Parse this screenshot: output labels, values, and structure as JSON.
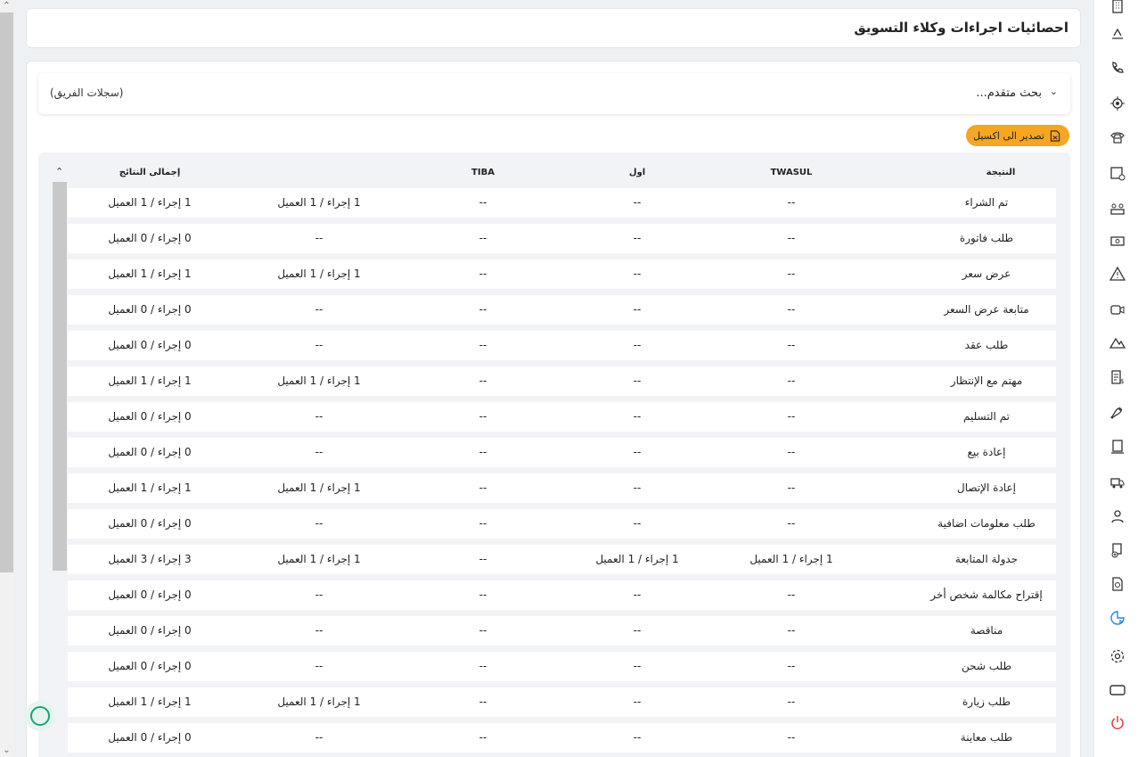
{
  "page_title": "احصائيات اجراءات وكلاء التسويق",
  "advanced_search": {
    "label": "بحث متقدم...",
    "team_records": "(سجلات الفريق)"
  },
  "export_button": "تصدير الى اكسيل",
  "table": {
    "headers": {
      "result": "النتيجة",
      "twasul": "TWASUL",
      "awal": "اول",
      "tiba": "TIBA",
      "other": "",
      "total": "إجمالى النتائج"
    },
    "rows": [
      {
        "result": "تم الشراء",
        "twasul": "--",
        "awal": "--",
        "tiba": "--",
        "other": "1 إجراء / 1 العميل",
        "total": "1 إجراء / 1 العميل"
      },
      {
        "result": "طلب فاتورة",
        "twasul": "--",
        "awal": "--",
        "tiba": "--",
        "other": "--",
        "total": "0 إجراء / 0 العميل"
      },
      {
        "result": "عرض سعر",
        "twasul": "--",
        "awal": "--",
        "tiba": "--",
        "other": "1 إجراء / 1 العميل",
        "total": "1 إجراء / 1 العميل"
      },
      {
        "result": "متابعة عرض السعر",
        "twasul": "--",
        "awal": "--",
        "tiba": "--",
        "other": "--",
        "total": "0 إجراء / 0 العميل"
      },
      {
        "result": "طلب عقد",
        "twasul": "--",
        "awal": "--",
        "tiba": "--",
        "other": "--",
        "total": "0 إجراء / 0 العميل"
      },
      {
        "result": "مهتم مع الإنتظار",
        "twasul": "--",
        "awal": "--",
        "tiba": "--",
        "other": "1 إجراء / 1 العميل",
        "total": "1 إجراء / 1 العميل"
      },
      {
        "result": "تم التسليم",
        "twasul": "--",
        "awal": "--",
        "tiba": "--",
        "other": "--",
        "total": "0 إجراء / 0 العميل"
      },
      {
        "result": "إعادة بيع",
        "twasul": "--",
        "awal": "--",
        "tiba": "--",
        "other": "--",
        "total": "0 إجراء / 0 العميل"
      },
      {
        "result": "إعادة الإتصال",
        "twasul": "--",
        "awal": "--",
        "tiba": "--",
        "other": "1 إجراء / 1 العميل",
        "total": "1 إجراء / 1 العميل"
      },
      {
        "result": "طلب معلومات اضافية",
        "twasul": "--",
        "awal": "--",
        "tiba": "--",
        "other": "--",
        "total": "0 إجراء / 0 العميل"
      },
      {
        "result": "جدولة المتابعة",
        "twasul": "1 إجراء / 1 العميل",
        "awal": "1 إجراء / 1 العميل",
        "tiba": "--",
        "other": "1 إجراء / 1 العميل",
        "total": "3 إجراء / 3 العميل"
      },
      {
        "result": "إقتراح مكالمة شخص أخر",
        "twasul": "--",
        "awal": "--",
        "tiba": "--",
        "other": "--",
        "total": "0 إجراء / 0 العميل"
      },
      {
        "result": "مناقصة",
        "twasul": "--",
        "awal": "--",
        "tiba": "--",
        "other": "--",
        "total": "0 إجراء / 0 العميل"
      },
      {
        "result": "طلب شحن",
        "twasul": "--",
        "awal": "--",
        "tiba": "--",
        "other": "--",
        "total": "0 إجراء / 0 العميل"
      },
      {
        "result": "طلب زيارة",
        "twasul": "--",
        "awal": "--",
        "tiba": "--",
        "other": "1 إجراء / 1 العميل",
        "total": "1 إجراء / 1 العميل"
      },
      {
        "result": "طلب معاينة",
        "twasul": "--",
        "awal": "--",
        "tiba": "--",
        "other": "--",
        "total": "0 إجراء / 0 العميل"
      }
    ]
  },
  "sidebar_icons": [
    "building-icon",
    "hand-money-icon",
    "phone-call-icon",
    "location-target-icon",
    "telephone-icon",
    "calendar-gear-icon",
    "people-group-icon",
    "cash-icon",
    "warning-icon",
    "video-icon",
    "mountain-icon",
    "invoice-dollar-icon",
    "signature-icon",
    "report-icon",
    "delivery-icon",
    "user-icon",
    "document-add-icon",
    "file-search-icon",
    "chart-pie-icon",
    "settings-icon",
    "screen-icon",
    "power-icon"
  ],
  "colors": {
    "accent": "#f5a623",
    "active_icon": "#1e88e5",
    "power": "#e53935",
    "fab": "#1aa37a"
  }
}
